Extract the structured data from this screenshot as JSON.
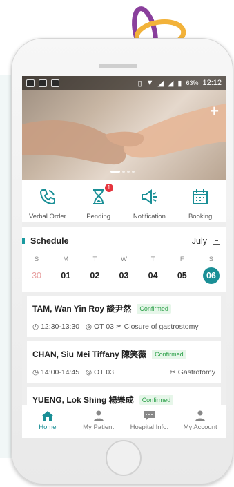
{
  "status_bar": {
    "battery": "63%",
    "time": "12:12"
  },
  "colors": {
    "accent": "#1a8f96",
    "badge": "#e5343d",
    "confirmed": "#2ba048"
  },
  "quick_actions": [
    {
      "label": "Verbal Order",
      "icon": "phone-call-icon"
    },
    {
      "label": "Pending",
      "icon": "hourglass-icon",
      "badge": "1"
    },
    {
      "label": "Notification",
      "icon": "megaphone-icon"
    },
    {
      "label": "Booking",
      "icon": "calendar-icon"
    }
  ],
  "schedule": {
    "title": "Schedule",
    "month": "July",
    "days": [
      {
        "dow": "S",
        "num": "30"
      },
      {
        "dow": "M",
        "num": "01"
      },
      {
        "dow": "T",
        "num": "02"
      },
      {
        "dow": "W",
        "num": "03"
      },
      {
        "dow": "T",
        "num": "04"
      },
      {
        "dow": "F",
        "num": "05"
      },
      {
        "dow": "S",
        "num": "06"
      }
    ]
  },
  "appointments": [
    {
      "name": "TAM, Wan Yin Roy 談尹然",
      "status": "Confirmed",
      "time": "12:30-13:30",
      "location": "OT 03",
      "procedure": "Closure of gastrostomy"
    },
    {
      "name": "CHAN, Siu Mei Tiffany 陳笑薇",
      "status": "Confirmed",
      "time": "14:00-14:45",
      "location": "OT 03",
      "procedure": "Gastrotomy"
    },
    {
      "name": "YUENG, Lok Shing 楊樂成",
      "status": "Confirmed",
      "time": "",
      "location": "",
      "procedure": ""
    }
  ],
  "bottom_nav": [
    {
      "label": "Home",
      "icon": "home-icon"
    },
    {
      "label": "My Patient",
      "icon": "patient-icon"
    },
    {
      "label": "Hospital Info.",
      "icon": "chat-icon"
    },
    {
      "label": "My Account",
      "icon": "user-icon"
    }
  ]
}
